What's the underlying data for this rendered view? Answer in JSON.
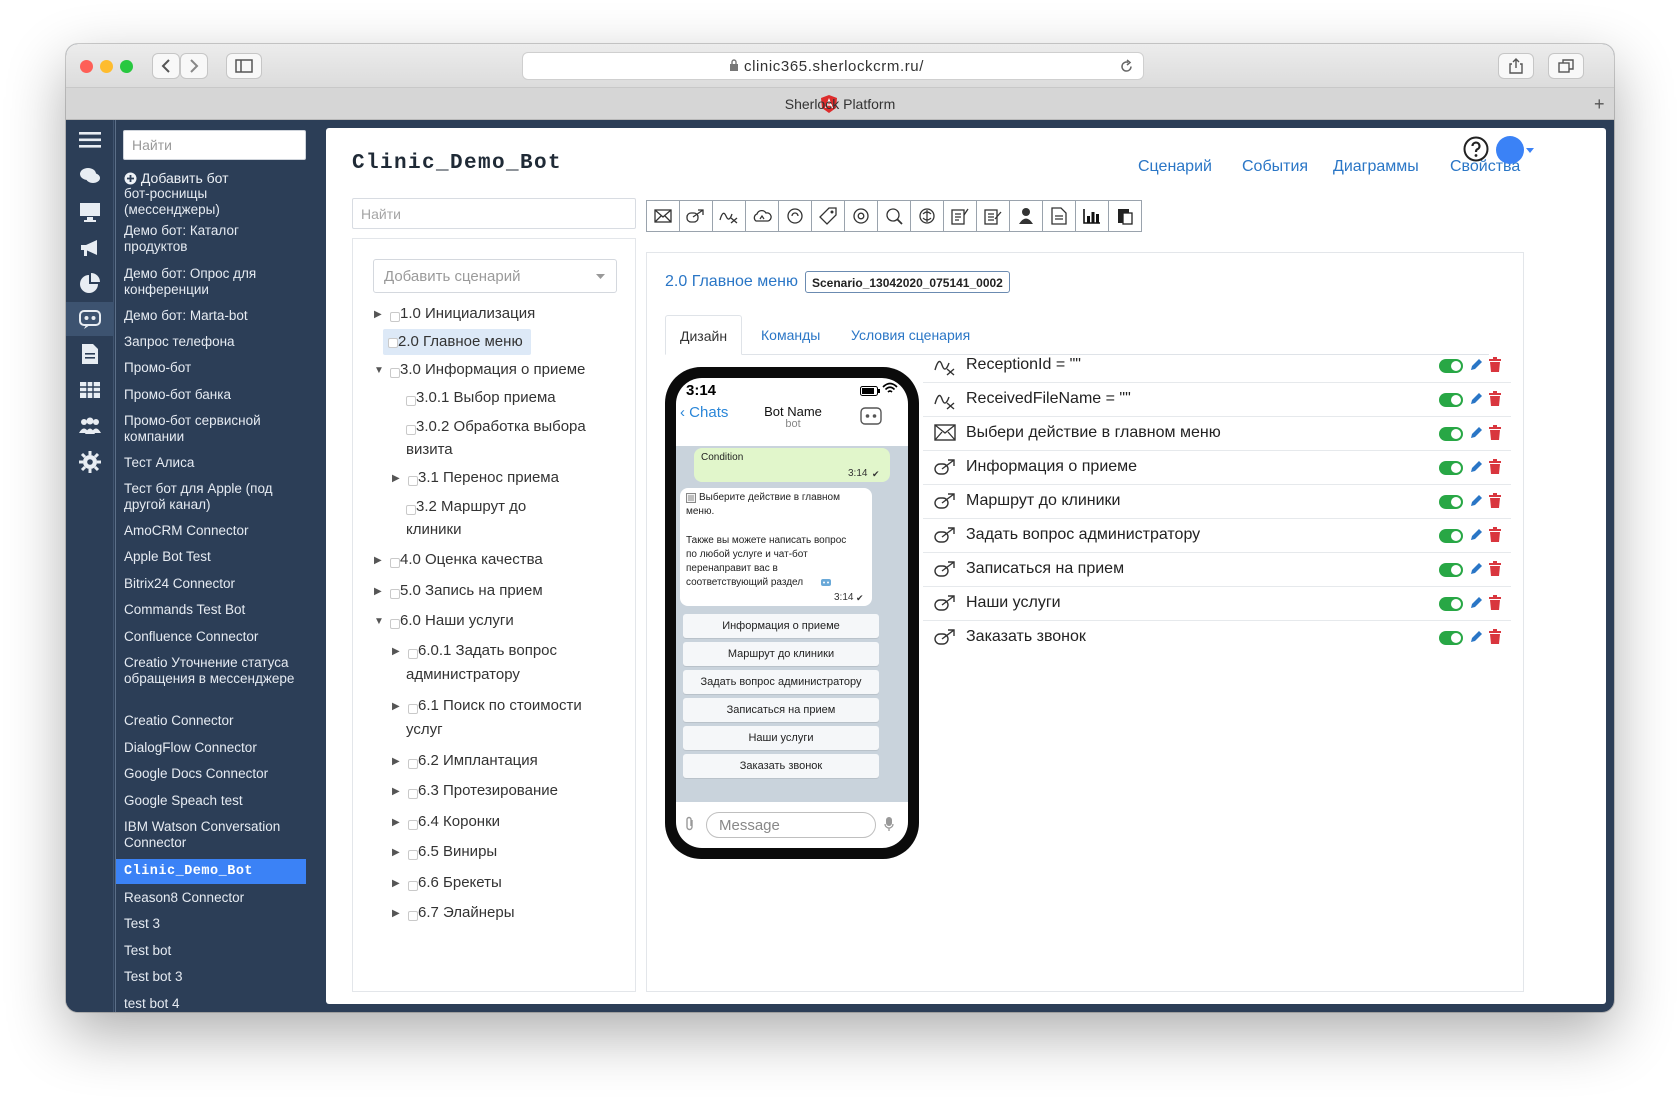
{
  "browser": {
    "url": "clinic365.sherlockcrm.ru/",
    "tab_title": "Sherlock Platform"
  },
  "sidebar": {
    "search_placeholder": "Найти",
    "add_bot": "Добавить бот",
    "items": [
      "бот-роснищы (мессенджеры)",
      "Демо бот: Каталог продуктов",
      "Демо бот: Опрос для конференции",
      "Демо бот: Marta-bot",
      "Запрос телефона",
      "Промо-бот",
      "Промо-бот банка",
      "Промо-бот сервисной компании",
      "Тест Алиса",
      "Тест бот для Apple (под другой канал)",
      "AmoCRM Connector",
      "Apple Bot Test",
      "Bitrix24 Connector",
      "Commands Test Bot",
      "Confluence Connector",
      "Creatio Уточнение статуса обращения в мессенджере",
      "Creatio Connector",
      "DialogFlow Connector",
      "Google Docs Connector",
      "Google Speach test",
      "IBM Watson Conversation Connector",
      "Clinic_Demo_Bot",
      "Reason8 Connector",
      "Test 3",
      "Test bot",
      "Test bot 3",
      "test bot 4"
    ]
  },
  "header": {
    "title": "Clinic_Demo_Bot",
    "nav": [
      "Сценарий",
      "События",
      "Диаграммы",
      "Свойства"
    ]
  },
  "tree": {
    "search_placeholder": "Найти",
    "add_scenario": "Добавить сценарий",
    "nodes": [
      "1.0 Инициализация",
      "2.0 Главное меню",
      "3.0 Информация о приеме",
      "3.0.1 Выбор приема",
      "3.0.2 Обработка выбора",
      "визита",
      "3.1 Перенос приема",
      "3.2 Маршрут до",
      "клиники",
      "4.0 Оценка качества",
      "5.0 Запись на прием",
      "6.0 Наши услуги",
      "6.0.1 Задать вопрос",
      "администратору",
      "6.1 Поиск по стоимости",
      "услуг",
      "6.2 Имплантация",
      "6.3 Протезирование",
      "6.4 Коронки",
      "6.5 Виниры",
      "6.6 Брекеты",
      "6.7 Элайнеры"
    ]
  },
  "scenario": {
    "title": "2.0 Главное меню",
    "id": "Scenario_13042020_075141_0002",
    "tabs": [
      "Дизайн",
      "Команды",
      "Условия сценария"
    ]
  },
  "commands": [
    {
      "icon": "variable-icon",
      "text": "ReceptionId = \"\""
    },
    {
      "icon": "variable-icon",
      "text": "ReceivedFileName = \"\""
    },
    {
      "icon": "message-icon",
      "text": "Выбери действие в главном меню"
    },
    {
      "icon": "redirect-icon",
      "text": "Информация о приеме"
    },
    {
      "icon": "redirect-icon",
      "text": "Маршрут до клиники"
    },
    {
      "icon": "redirect-icon",
      "text": "Задать вопрос администратору"
    },
    {
      "icon": "redirect-icon",
      "text": "Записаться на прием"
    },
    {
      "icon": "redirect-icon",
      "text": "Наши услуги"
    },
    {
      "icon": "redirect-icon",
      "text": "Заказать звонок"
    }
  ],
  "phone": {
    "time": "3:14",
    "back": "Chats",
    "bot_name": "Bot Name",
    "bot_sub": "bot",
    "condition": "Condition",
    "condition_time": "3:14",
    "msg_line1": "Выберите действие в главном",
    "msg_line2": "меню.",
    "msg_line3": "Также вы можете написать вопрос",
    "msg_line4": "по любой услуге и чат-бот",
    "msg_line5": "перенаправит вас в",
    "msg_line6": "соответствующий раздел",
    "msg_time": "3:14",
    "buttons": [
      "Информация о приеме",
      "Маршрут до клиники",
      "Задать вопрос администратору",
      "Записаться на прием",
      "Наши услуги",
      "Заказать звонок"
    ],
    "message_placeholder": "Message"
  },
  "colors": {
    "accent": "#2a76c6",
    "sidebar": "#2c3e57",
    "active": "#3b82f6",
    "toggle_on": "#28a745",
    "delete": "#d9363e"
  }
}
